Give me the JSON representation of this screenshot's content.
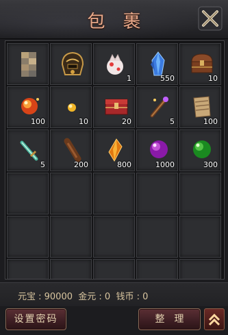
{
  "header": {
    "title": "包裹"
  },
  "items": [
    {
      "icon": "blurred-item-icon",
      "count": ""
    },
    {
      "icon": "golden-helmet-icon",
      "count": ""
    },
    {
      "icon": "pet-egg-icon",
      "count": "1"
    },
    {
      "icon": "blue-crystal-icon",
      "count": "550"
    },
    {
      "icon": "treasure-chest-icon",
      "count": "10"
    },
    {
      "icon": "fire-orb-icon",
      "count": "100"
    },
    {
      "icon": "gold-pearl-icon",
      "count": "10"
    },
    {
      "icon": "red-chest-icon",
      "count": "20"
    },
    {
      "icon": "magic-rod-icon",
      "count": "5"
    },
    {
      "icon": "scroll-icon",
      "count": "100"
    },
    {
      "icon": "jade-sword-icon",
      "count": "5"
    },
    {
      "icon": "wood-log-icon",
      "count": "200"
    },
    {
      "icon": "amber-crystal-icon",
      "count": "800"
    },
    {
      "icon": "purple-orb-icon",
      "count": "1000"
    },
    {
      "icon": "green-orb-icon",
      "count": "300"
    }
  ],
  "currency_line": "元宝 : 90000  金元 : 0  钱币 : 0",
  "buttons": {
    "set_password": "设置密码",
    "sort": "整理"
  }
}
